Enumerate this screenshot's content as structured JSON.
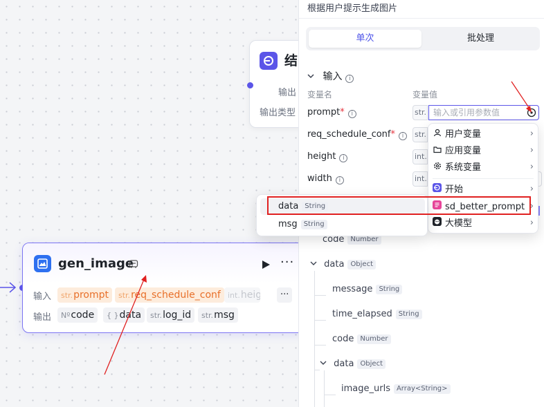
{
  "end_node": {
    "title": "结",
    "output_label": "输出",
    "output_type_label": "输出类型"
  },
  "gen_node": {
    "title": "gen_image",
    "input_label": "输入",
    "output_label": "输出",
    "inputs": [
      {
        "prefix": "str.",
        "name": "prompt"
      },
      {
        "prefix": "str.",
        "name": "req_schedule_conf"
      },
      {
        "prefix": "int.",
        "name": "heig"
      }
    ],
    "more": "···",
    "outputs": [
      {
        "prefix": "Nº",
        "name": "code"
      },
      {
        "prefix": "{ }",
        "name": "data"
      },
      {
        "prefix": "str.",
        "name": "log_id"
      },
      {
        "prefix": "str.",
        "name": "msg"
      }
    ]
  },
  "panel": {
    "description": "根据用户提示生成图片",
    "tabs": [
      "单次",
      "批处理"
    ],
    "section_title": "输入",
    "col_name": "变量名",
    "col_value": "变量值",
    "variables": [
      {
        "name": "prompt",
        "required": true,
        "type": "str."
      },
      {
        "name": "req_schedule_conf",
        "required": true,
        "type": "str."
      },
      {
        "name": "height",
        "required": false,
        "type": "int."
      },
      {
        "name": "width",
        "required": false,
        "type": "int."
      }
    ],
    "input_placeholder": "输入或引用参数值",
    "tree": [
      {
        "name": "code",
        "type": "Number"
      },
      {
        "name": "data",
        "type": "Object"
      },
      {
        "name": "message",
        "type": "String"
      },
      {
        "name": "time_elapsed",
        "type": "String"
      },
      {
        "name": "code",
        "type": "Number"
      },
      {
        "name": "data",
        "type": "Object"
      },
      {
        "name": "image_urls",
        "type": "Array<String>"
      }
    ]
  },
  "menu": {
    "items": [
      {
        "label": "用户变量",
        "icon": "user-icon"
      },
      {
        "label": "应用变量",
        "icon": "folder-icon"
      },
      {
        "label": "系统变量",
        "icon": "gear-icon"
      },
      {
        "label": "开始",
        "icon": "start-node-icon"
      },
      {
        "label": "sd_better_prompt",
        "icon": "prompt-node-icon"
      },
      {
        "label": "大模型",
        "icon": "llm-node-icon"
      }
    ]
  },
  "submenu": {
    "items": [
      {
        "label": "data",
        "type": "String"
      },
      {
        "label": "msg",
        "type": "String"
      }
    ]
  },
  "colors": {
    "accent": "#5b55e8",
    "annotation_red": "#e02020",
    "prompt_node": "#e8459a",
    "image_node": "#2e70f0",
    "chip_orange": "#e8702a"
  }
}
